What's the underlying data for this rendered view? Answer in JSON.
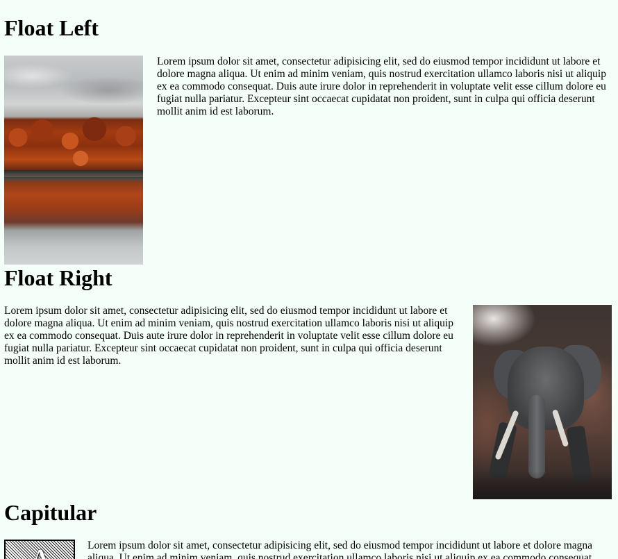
{
  "sections": {
    "float_left": {
      "heading": "Float Left",
      "lines": [
        "Lorem ipsum dolor sit amet, consectetur adipisicing elit, sed do eiusmod tempor incididunt ut labore et",
        "dolore magna aliqua. Ut enim ad minim veniam, quis nostrud exercitation ullamco laboris nisi ut aliquip",
        "ex ea commodo consequat. Duis aute irure dolor in reprehenderit in voluptate velit esse cillum dolore eu",
        "fugiat nulla pariatur. Excepteur sint occaecat cupidatat non proident, sunt in culpa qui officia deserunt",
        "mollit anim id est laborum."
      ]
    },
    "float_right": {
      "heading": "Float Right",
      "lines": [
        "Lorem ipsum dolor sit amet, consectetur adipisicing elit, sed do eiusmod tempor incididunt ut labore et",
        "dolore magna aliqua. Ut enim ad minim veniam, quis nostrud exercitation ullamco laboris nisi ut aliquip",
        "ex ea commodo consequat. Duis aute irure dolor in reprehenderit in voluptate velit esse cillum dolore eu",
        "fugiat nulla pariatur. Excepteur sint occaecat cupidatat non proident, sunt in culpa qui officia deserunt",
        "mollit anim id est laborum."
      ]
    },
    "capitular": {
      "heading": "Capitular",
      "initial": "A",
      "lines": [
        "Lorem ipsum dolor sit amet, consectetur adipisicing elit, sed do eiusmod tempor incididunt ut labore et dolore magna",
        "aliqua. Ut enim ad minim veniam, quis nostrud exercitation ullamco laboris nisi ut aliquip ex ea commodo consequat."
      ]
    }
  },
  "colors": {
    "page_background": "#f5fff9",
    "text": "#000000"
  }
}
